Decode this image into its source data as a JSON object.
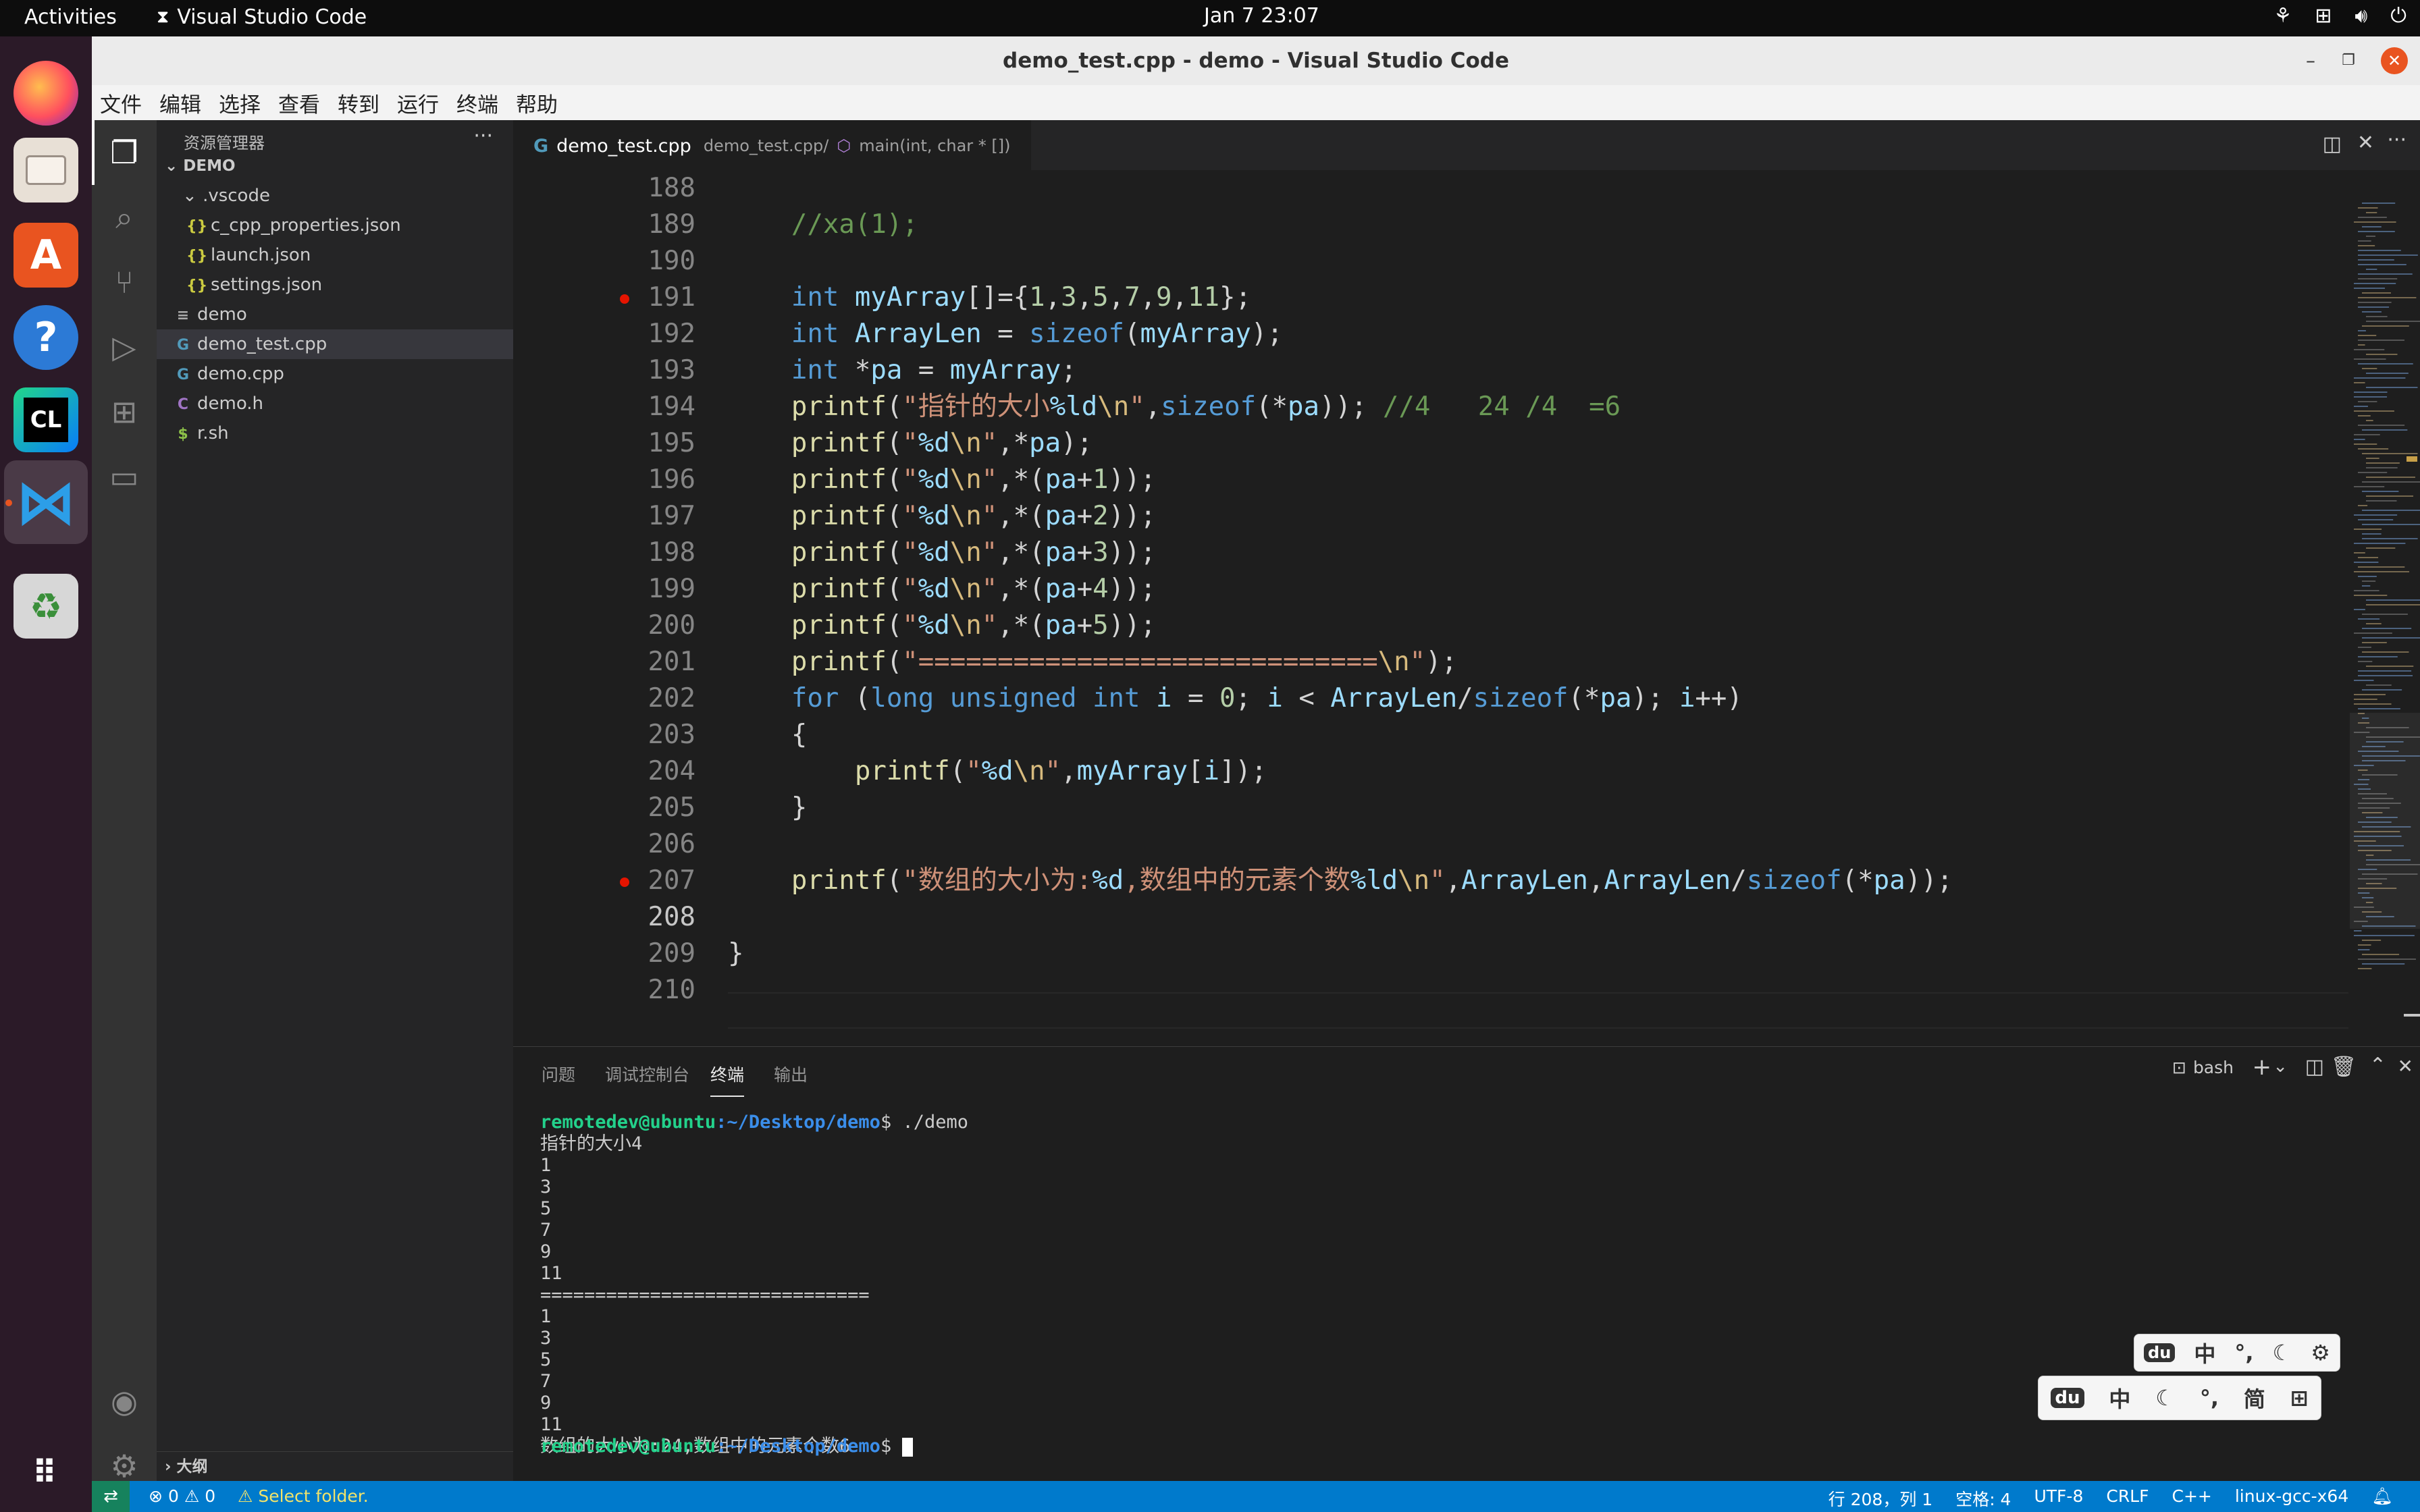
{
  "topbar": {
    "activities": "Activities",
    "app_name": "Visual Studio Code",
    "clock": "Jan 7  23:07"
  },
  "window": {
    "title": "demo_test.cpp - demo - Visual Studio Code"
  },
  "menu": [
    "文件",
    "编辑",
    "选择",
    "查看",
    "转到",
    "运行",
    "终端",
    "帮助"
  ],
  "sidebar": {
    "title": "资源管理器",
    "root": "DEMO",
    "outline": "大纲",
    "items": [
      {
        "label": ".vscode",
        "icon": "folder-open-chevron"
      },
      {
        "label": "c_cpp_properties.json",
        "icon": "json-icon"
      },
      {
        "label": "launch.json",
        "icon": "json-icon"
      },
      {
        "label": "settings.json",
        "icon": "json-icon"
      },
      {
        "label": "demo",
        "icon": "file-lines-icon"
      },
      {
        "label": "demo_test.cpp",
        "icon": "cpp-icon"
      },
      {
        "label": "demo.cpp",
        "icon": "cpp-icon"
      },
      {
        "label": "demo.h",
        "icon": "c-header-icon"
      },
      {
        "label": "r.sh",
        "icon": "shell-icon"
      }
    ]
  },
  "editor": {
    "tab_label": "demo_test.cpp",
    "breadcrumb_file": "demo_test.cpp/",
    "breadcrumb_symbol": "main(int, char * [])",
    "current_line": 208,
    "breakpoint_lines": [
      191,
      207
    ],
    "lines": [
      {
        "n": "188",
        "html": ""
      },
      {
        "n": "189",
        "html": "    <span class=\"c\">//xa(1);</span>"
      },
      {
        "n": "190",
        "html": ""
      },
      {
        "n": "191",
        "html": "    <span class=\"k\">int</span> <span class=\"v\">myArray</span>[]={<span class=\"n\">1</span>,<span class=\"n\">3</span>,<span class=\"n\">5</span>,<span class=\"n\">7</span>,<span class=\"n\">9</span>,<span class=\"n\">11</span>};"
      },
      {
        "n": "192",
        "html": "    <span class=\"k\">int</span> <span class=\"v\">ArrayLen</span> = <span class=\"k\">sizeof</span>(<span class=\"v\">myArray</span>);"
      },
      {
        "n": "193",
        "html": "    <span class=\"k\">int</span> *<span class=\"v\">pa</span> = <span class=\"v\">myArray</span>;"
      },
      {
        "n": "194",
        "html": "    <span class=\"f\">printf</span>(<span class=\"s\">\"指针的大小</span><span class=\"v\">%ld</span><span class=\"e\">\\n</span><span class=\"s\">\"</span>,<span class=\"k\">sizeof</span>(*<span class=\"v\">pa</span>)); <span class=\"c\">//4   24 /4  =6</span>"
      },
      {
        "n": "195",
        "html": "    <span class=\"f\">printf</span>(<span class=\"s\">\"</span><span class=\"v\">%d</span><span class=\"e\">\\n</span><span class=\"s\">\"</span>,*<span class=\"v\">pa</span>);"
      },
      {
        "n": "196",
        "html": "    <span class=\"f\">printf</span>(<span class=\"s\">\"</span><span class=\"v\">%d</span><span class=\"e\">\\n</span><span class=\"s\">\"</span>,*(<span class=\"v\">pa</span>+<span class=\"n\">1</span>));"
      },
      {
        "n": "197",
        "html": "    <span class=\"f\">printf</span>(<span class=\"s\">\"</span><span class=\"v\">%d</span><span class=\"e\">\\n</span><span class=\"s\">\"</span>,*(<span class=\"v\">pa</span>+<span class=\"n\">2</span>));"
      },
      {
        "n": "198",
        "html": "    <span class=\"f\">printf</span>(<span class=\"s\">\"</span><span class=\"v\">%d</span><span class=\"e\">\\n</span><span class=\"s\">\"</span>,*(<span class=\"v\">pa</span>+<span class=\"n\">3</span>));"
      },
      {
        "n": "199",
        "html": "    <span class=\"f\">printf</span>(<span class=\"s\">\"</span><span class=\"v\">%d</span><span class=\"e\">\\n</span><span class=\"s\">\"</span>,*(<span class=\"v\">pa</span>+<span class=\"n\">4</span>));"
      },
      {
        "n": "200",
        "html": "    <span class=\"f\">printf</span>(<span class=\"s\">\"</span><span class=\"v\">%d</span><span class=\"e\">\\n</span><span class=\"s\">\"</span>,*(<span class=\"v\">pa</span>+<span class=\"n\">5</span>));"
      },
      {
        "n": "201",
        "html": "    <span class=\"f\">printf</span>(<span class=\"s\">\"=============================</span><span class=\"e\">\\n</span><span class=\"s\">\"</span>);"
      },
      {
        "n": "202",
        "html": "    <span class=\"k\">for</span> (<span class=\"k\">long unsigned int</span> <span class=\"v\">i</span> = <span class=\"n\">0</span>; <span class=\"v\">i</span> &lt; <span class=\"v\">ArrayLen</span>/<span class=\"k\">sizeof</span>(*<span class=\"v\">pa</span>); <span class=\"v\">i</span>++)"
      },
      {
        "n": "203",
        "html": "    {"
      },
      {
        "n": "204",
        "html": "        <span class=\"f\">printf</span>(<span class=\"s\">\"</span><span class=\"v\">%d</span><span class=\"e\">\\n</span><span class=\"s\">\"</span>,<span class=\"v\">myArray</span>[<span class=\"v\">i</span>]);"
      },
      {
        "n": "205",
        "html": "    }"
      },
      {
        "n": "206",
        "html": ""
      },
      {
        "n": "207",
        "html": "    <span class=\"f\">printf</span>(<span class=\"s\">\"数组的大小为:</span><span class=\"v\">%d</span><span class=\"s\">,数组中的元素个数</span><span class=\"v\">%ld</span><span class=\"e\">\\n</span><span class=\"s\">\"</span>,<span class=\"v\">ArrayLen</span>,<span class=\"v\">ArrayLen</span>/<span class=\"k\">sizeof</span>(*<span class=\"v\">pa</span>));"
      },
      {
        "n": "208",
        "html": ""
      },
      {
        "n": "209",
        "html": "}"
      },
      {
        "n": "210",
        "html": ""
      }
    ]
  },
  "panel": {
    "tabs": [
      "问题",
      "调试控制台",
      "终端",
      "输出"
    ],
    "active_tab": "终端",
    "shell": "bash",
    "prompt_user": "remotedev@ubuntu",
    "prompt_path": ":~/Desktop/demo",
    "prompt_end": "$ ",
    "command": "./demo",
    "output": [
      "指针的大小4",
      "1",
      "3",
      "5",
      "7",
      "9",
      "11",
      "==============================",
      "1",
      "3",
      "5",
      "7",
      "9",
      "11",
      "数组的大小为:24,数组中的元素个数6"
    ]
  },
  "statusbar": {
    "errors": "0",
    "warnings": "0",
    "select_folder": "Select folder.",
    "position": "行 208，列 1",
    "spaces": "空格: 4",
    "encoding": "UTF-8",
    "eol": "CRLF",
    "language": "C++",
    "config": "linux-gcc-x64"
  },
  "ime": {
    "bar1": [
      "中",
      "°,",
      "☾",
      "⚙"
    ],
    "bar2": [
      "中",
      "☾",
      "°,",
      "简",
      "⊞"
    ]
  },
  "colors": {
    "accent": "#007acc",
    "breakpoint": "#e51400",
    "ubuntu_orange": "#e95420"
  }
}
